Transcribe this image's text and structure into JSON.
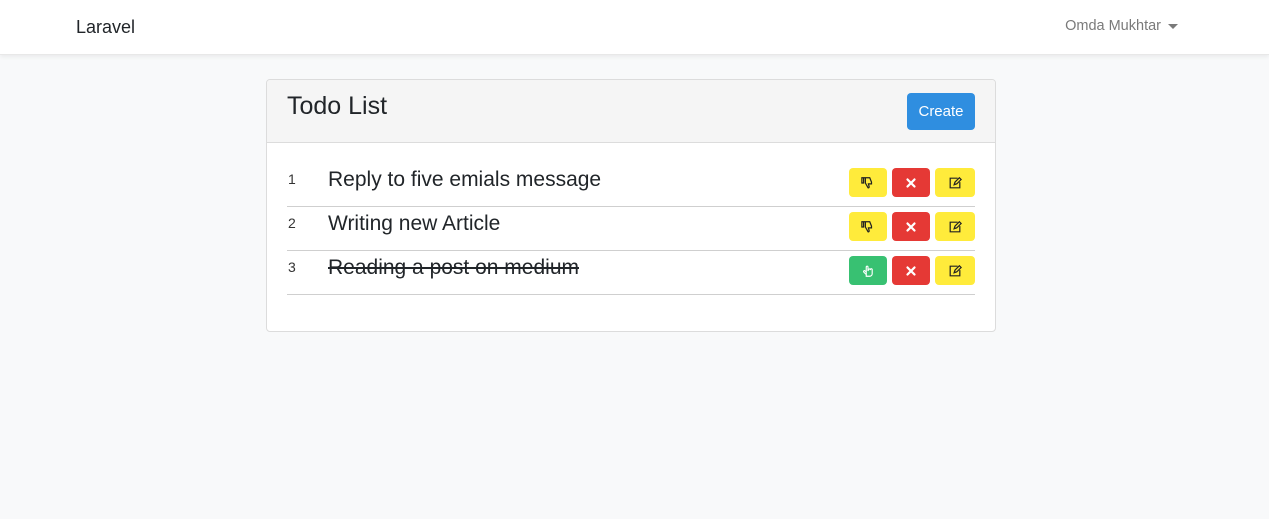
{
  "navbar": {
    "brand": "Laravel",
    "user_name": "Omda Mukhtar"
  },
  "card": {
    "title": "Todo List",
    "create_label": "Create"
  },
  "todos": [
    {
      "num": "1",
      "text": "Reply to five emials message",
      "done": false,
      "toggle_icon": "thumbs-down-icon"
    },
    {
      "num": "2",
      "text": "Writing new Article",
      "done": false,
      "toggle_icon": "thumbs-down-icon"
    },
    {
      "num": "3",
      "text": "Reading a post on medium",
      "done": true,
      "toggle_icon": "hand-pointer-icon"
    }
  ],
  "colors": {
    "primary": "#2f8ee0",
    "warning": "#ffeb3b",
    "danger": "#e53935",
    "success": "#38c172"
  }
}
